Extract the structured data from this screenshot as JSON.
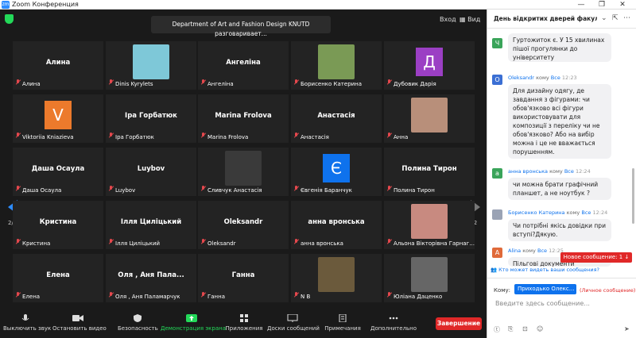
{
  "window": {
    "title": "Zoom Конференция",
    "logo": "zm",
    "min": "—",
    "max": "❐",
    "close": "✕"
  },
  "meeting": {
    "banner_line1": "Department of Art and Fashion Design KNUTD разговаривает...",
    "enter_label": "Вход",
    "view_label": "Вид"
  },
  "gallery": {
    "page_left": "2/2",
    "page_right": "2/2",
    "tiles": [
      {
        "name": "Алина",
        "label": "Алина"
      },
      {
        "name": "",
        "label": "Dinis Kyrylets"
      },
      {
        "name": "Ангеліна",
        "label": "Ангеліна"
      },
      {
        "name": "",
        "label": "Борисенко Катерина"
      },
      {
        "name": "",
        "label": "Дубовик Дарія",
        "letter": "Д"
      },
      {
        "name": "",
        "label": "Viktoriia Kniazieva",
        "letter": "V"
      },
      {
        "name": "Іра Горбатюк",
        "label": "Іра Горбатюк"
      },
      {
        "name": "Marina Frolova",
        "label": "Marina Frolova"
      },
      {
        "name": "Анастасія",
        "label": "Анастасія"
      },
      {
        "name": "",
        "label": "Анна"
      },
      {
        "name": "Даша Осаула",
        "label": "Даша Осаула"
      },
      {
        "name": "Luybov",
        "label": "Luybov"
      },
      {
        "name": "",
        "label": "Сливчук Анастасія"
      },
      {
        "name": "",
        "label": "Євгенія Баранчук",
        "letter": "Є"
      },
      {
        "name": "Полина Тирон",
        "label": "Полина Тирон"
      },
      {
        "name": "Кристина",
        "label": "Кристина"
      },
      {
        "name": "Ілля Циліцький",
        "label": "Ілля Циліцький"
      },
      {
        "name": "Oleksandr",
        "label": "Oleksandr"
      },
      {
        "name": "анна вронська",
        "label": "анна вронська"
      },
      {
        "name": "",
        "label": "Альона Вікторівна Гарнаг..."
      },
      {
        "name": "Елена",
        "label": "Елена"
      },
      {
        "name": "Оля , Аня Пала...",
        "label": "Оля , Аня Паламарчук"
      },
      {
        "name": "Ганна",
        "label": "Ганна"
      },
      {
        "name": "",
        "label": "N B"
      },
      {
        "name": "",
        "label": "Юліана Даценко"
      }
    ]
  },
  "toolbar": {
    "mute": "Выключить звук",
    "video": "Остановить видео",
    "security": "Безопасность",
    "share": "Демонстрация экрана",
    "apps": "Приложения",
    "whiteboards": "Доски сообщений",
    "notes": "Примечания",
    "more": "Дополнительно",
    "end": "Завершение"
  },
  "chat": {
    "title": "День відкритих дверей факульт...",
    "messages": [
      {
        "avatar": "Ч",
        "color": "#3aa45a",
        "sender": "",
        "to": "",
        "time": "",
        "text": "Гуртожиток є. У 15 хвилинах пішої прогулянки до університету"
      },
      {
        "avatar": "O",
        "color": "#3b6fd4",
        "sender": "Oleksandr",
        "to": "кому",
        "all": "Все",
        "time": "12:23",
        "text": "Для дизайну одягу, де завдання з фігурами: чи обов'язково всі фігури використовувати для композиції з переліку чи не обов'язково? Або на вибір можна і це не вважається порушенням."
      },
      {
        "avatar": "а",
        "color": "#3aa45a",
        "sender": "анна вронська",
        "to": "кому",
        "all": "Все",
        "time": "12:24",
        "text": "чи можна брати графічний планшет, а не ноутбук ?"
      },
      {
        "avatar": "",
        "color": "#9aa3b5",
        "sender": "Борисенко Катерина",
        "to": "кому",
        "all": "Все",
        "time": "12:24",
        "text": "Чи потрібні якісь довідки при вступі?Дякую."
      },
      {
        "avatar": "A",
        "color": "#e06a3a",
        "sender": "Alina",
        "to": "кому",
        "all": "Все",
        "time": "12:25",
        "text": "Пільгові документи"
      }
    ],
    "new_message": "Новое сообщение: 1 ↓",
    "who_can_see": "Кто может видеть ваши сообщения?",
    "to_label": "Кому:",
    "recipient": "Приходько Олекс...",
    "private": "(Личное сообщение)",
    "placeholder": "Введите здесь сообщение..."
  }
}
